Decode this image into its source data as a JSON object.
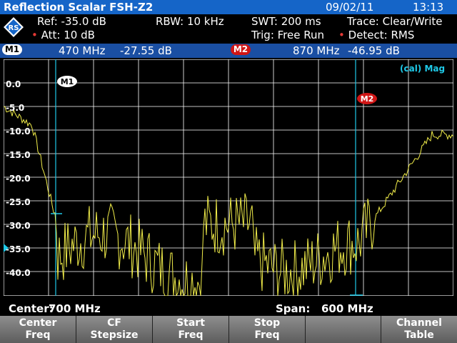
{
  "title": "Reflection Scalar FSH-Z2",
  "date": "09/02/11",
  "time": "13:13",
  "settings": {
    "ref": "Ref:  -35.0 dB",
    "att": "Att:  10 dB",
    "rbw": "RBW:  10 kHz",
    "swt": "SWT:   200 ms",
    "trig": "Trig:   Free Run",
    "trace": "Trace:   Clear/Write",
    "detect": "Detect:  RMS"
  },
  "markers": {
    "m1_label": "M1",
    "m1_freq": "470 MHz",
    "m1_level": "-27.55 dB",
    "m2_label": "M2",
    "m2_freq": "870 MHz",
    "m2_level": "-46.95 dB"
  },
  "plot": {
    "mode_label": "(cal) Mag",
    "y_ticks": [
      "0.0",
      "-5.0",
      "-10.0",
      "-15.0",
      "-20.0",
      "-25.0",
      "-30.0",
      "-35.0",
      "-40.0"
    ]
  },
  "status": {
    "center_label": "Center:",
    "center_value": "700 MHz",
    "span_label": "Span:",
    "span_value": "600 MHz"
  },
  "softkeys": [
    {
      "line1": "Center",
      "line2": "Freq"
    },
    {
      "line1": "CF",
      "line2": "Stepsize"
    },
    {
      "line1": "Start",
      "line2": "Freq"
    },
    {
      "line1": "Stop",
      "line2": "Freq"
    },
    {
      "line1": "",
      "line2": ""
    },
    {
      "line1": "Channel",
      "line2": "Table"
    }
  ],
  "colors": {
    "title_bar": "#1565c8",
    "marker_bar": "#1a4fa3",
    "trace": "#f2ee4a",
    "marker_line": "#1fc9e8",
    "m2_badge": "#d01616"
  }
}
